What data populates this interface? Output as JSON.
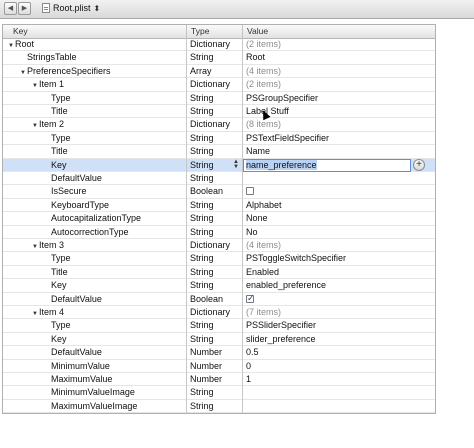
{
  "window": {
    "file_name": "Root.plist"
  },
  "columns": {
    "key": "Key",
    "type": "Type",
    "value": "Value"
  },
  "rows": [
    {
      "key": "Root",
      "level": 0,
      "expand": "open",
      "type": "Dictionary",
      "value": "(2 items)",
      "kind": "muted"
    },
    {
      "key": "StringsTable",
      "level": 1,
      "expand": "none",
      "type": "String",
      "value": "Root",
      "kind": "text"
    },
    {
      "key": "PreferenceSpecifiers",
      "level": 1,
      "expand": "open",
      "type": "Array",
      "value": "(4 items)",
      "kind": "muted"
    },
    {
      "key": "Item 1",
      "level": 2,
      "expand": "open",
      "type": "Dictionary",
      "value": "(2 items)",
      "kind": "muted"
    },
    {
      "key": "Type",
      "level": 3,
      "expand": "none",
      "type": "String",
      "value": "PSGroupSpecifier",
      "kind": "text"
    },
    {
      "key": "Title",
      "level": 3,
      "expand": "none",
      "type": "String",
      "value": "Label Stuff",
      "kind": "text"
    },
    {
      "key": "Item 2",
      "level": 2,
      "expand": "open",
      "type": "Dictionary",
      "value": "(8 items)",
      "kind": "muted"
    },
    {
      "key": "Type",
      "level": 3,
      "expand": "none",
      "type": "String",
      "value": "PSTextFieldSpecifier",
      "kind": "text"
    },
    {
      "key": "Title",
      "level": 3,
      "expand": "none",
      "type": "String",
      "value": "Name",
      "kind": "text"
    },
    {
      "key": "Key",
      "level": 3,
      "expand": "none",
      "type": "String",
      "value": "name_preference",
      "kind": "editing"
    },
    {
      "key": "DefaultValue",
      "level": 3,
      "expand": "none",
      "type": "String",
      "value": "",
      "kind": "text"
    },
    {
      "key": "IsSecure",
      "level": 3,
      "expand": "none",
      "type": "Boolean",
      "value": "",
      "kind": "checkbox",
      "checked": false
    },
    {
      "key": "KeyboardType",
      "level": 3,
      "expand": "none",
      "type": "String",
      "value": "Alphabet",
      "kind": "text"
    },
    {
      "key": "AutocapitalizationType",
      "level": 3,
      "expand": "none",
      "type": "String",
      "value": "None",
      "kind": "text"
    },
    {
      "key": "AutocorrectionType",
      "level": 3,
      "expand": "none",
      "type": "String",
      "value": "No",
      "kind": "text"
    },
    {
      "key": "Item 3",
      "level": 2,
      "expand": "open",
      "type": "Dictionary",
      "value": "(4 items)",
      "kind": "muted"
    },
    {
      "key": "Type",
      "level": 3,
      "expand": "none",
      "type": "String",
      "value": "PSToggleSwitchSpecifier",
      "kind": "text"
    },
    {
      "key": "Title",
      "level": 3,
      "expand": "none",
      "type": "String",
      "value": "Enabled",
      "kind": "text"
    },
    {
      "key": "Key",
      "level": 3,
      "expand": "none",
      "type": "String",
      "value": "enabled_preference",
      "kind": "text"
    },
    {
      "key": "DefaultValue",
      "level": 3,
      "expand": "none",
      "type": "Boolean",
      "value": "",
      "kind": "checkbox",
      "checked": true
    },
    {
      "key": "Item 4",
      "level": 2,
      "expand": "open",
      "type": "Dictionary",
      "value": "(7 items)",
      "kind": "muted"
    },
    {
      "key": "Type",
      "level": 3,
      "expand": "none",
      "type": "String",
      "value": "PSSliderSpecifier",
      "kind": "text"
    },
    {
      "key": "Key",
      "level": 3,
      "expand": "none",
      "type": "String",
      "value": "slider_preference",
      "kind": "text"
    },
    {
      "key": "DefaultValue",
      "level": 3,
      "expand": "none",
      "type": "Number",
      "value": "0.5",
      "kind": "text"
    },
    {
      "key": "MinimumValue",
      "level": 3,
      "expand": "none",
      "type": "Number",
      "value": "0",
      "kind": "text"
    },
    {
      "key": "MaximumValue",
      "level": 3,
      "expand": "none",
      "type": "Number",
      "value": "1",
      "kind": "text"
    },
    {
      "key": "MinimumValueImage",
      "level": 3,
      "expand": "none",
      "type": "String",
      "value": "",
      "kind": "text"
    },
    {
      "key": "MaximumValueImage",
      "level": 3,
      "expand": "none",
      "type": "String",
      "value": "",
      "kind": "text"
    }
  ],
  "selected_row": 9,
  "icons": {
    "back": "chevron-left-icon",
    "forward": "chevron-right-icon",
    "file": "plist-file-icon",
    "add": "plus-icon",
    "stepper": "up-down-stepper-icon"
  }
}
